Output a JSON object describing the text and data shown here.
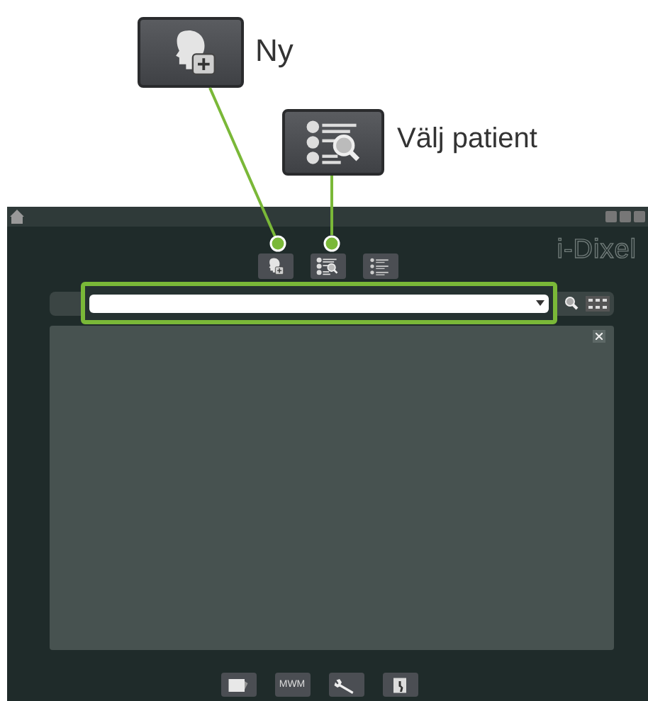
{
  "callouts": [
    {
      "kind": "new",
      "label": "Ny"
    },
    {
      "kind": "select",
      "label": "Välj patient"
    }
  ],
  "window": {
    "logo": "i-Dixel",
    "toolbar": [
      {
        "kind": "new"
      },
      {
        "kind": "select"
      },
      {
        "kind": "list"
      }
    ],
    "bottom_toolbar": [
      {
        "kind": "notes"
      },
      {
        "kind": "text",
        "label": "MWM"
      },
      {
        "kind": "tools"
      },
      {
        "kind": "exit"
      }
    ]
  }
}
